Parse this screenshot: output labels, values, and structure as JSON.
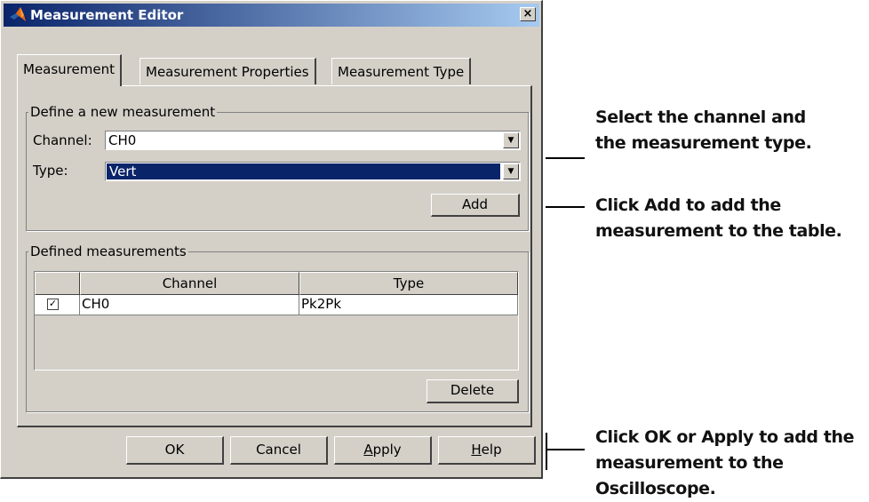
{
  "window": {
    "title": "Measurement Editor",
    "close_label": "×"
  },
  "tabs": [
    {
      "label": "Measurement",
      "active": true
    },
    {
      "label": "Measurement Properties",
      "active": false
    },
    {
      "label": "Measurement Type",
      "active": false
    }
  ],
  "define_group": {
    "legend": "Define a new measurement",
    "channel_label": "Channel:",
    "channel_value": "CH0",
    "type_label": "Type:",
    "type_value": "Vert",
    "add_label": "Add"
  },
  "defined_group": {
    "legend": "Defined measurements",
    "columns": [
      "Channel",
      "Type"
    ],
    "rows": [
      {
        "checked": true,
        "channel": "CH0",
        "type": "Pk2Pk"
      }
    ],
    "delete_label": "Delete"
  },
  "buttons": {
    "ok": "OK",
    "cancel": "Cancel",
    "apply_mnemonic": "A",
    "apply_rest": "pply",
    "help_mnemonic": "H",
    "help_rest": "elp"
  },
  "annotations": {
    "select": [
      "Select the channel and",
      "the measurement type."
    ],
    "add": {
      "pre": "Click ",
      "bold": "Add",
      "post": " to add the",
      "line2": "measurement to the table."
    },
    "ok": {
      "pre": "Click ",
      "bold1": "OK",
      "mid": " or ",
      "bold2": "Apply",
      "post": " to add the",
      "line2": "measurement to the Oscilloscope."
    }
  },
  "colors": {
    "selection": "#0a246a",
    "dialog": "#d4d0c8"
  }
}
